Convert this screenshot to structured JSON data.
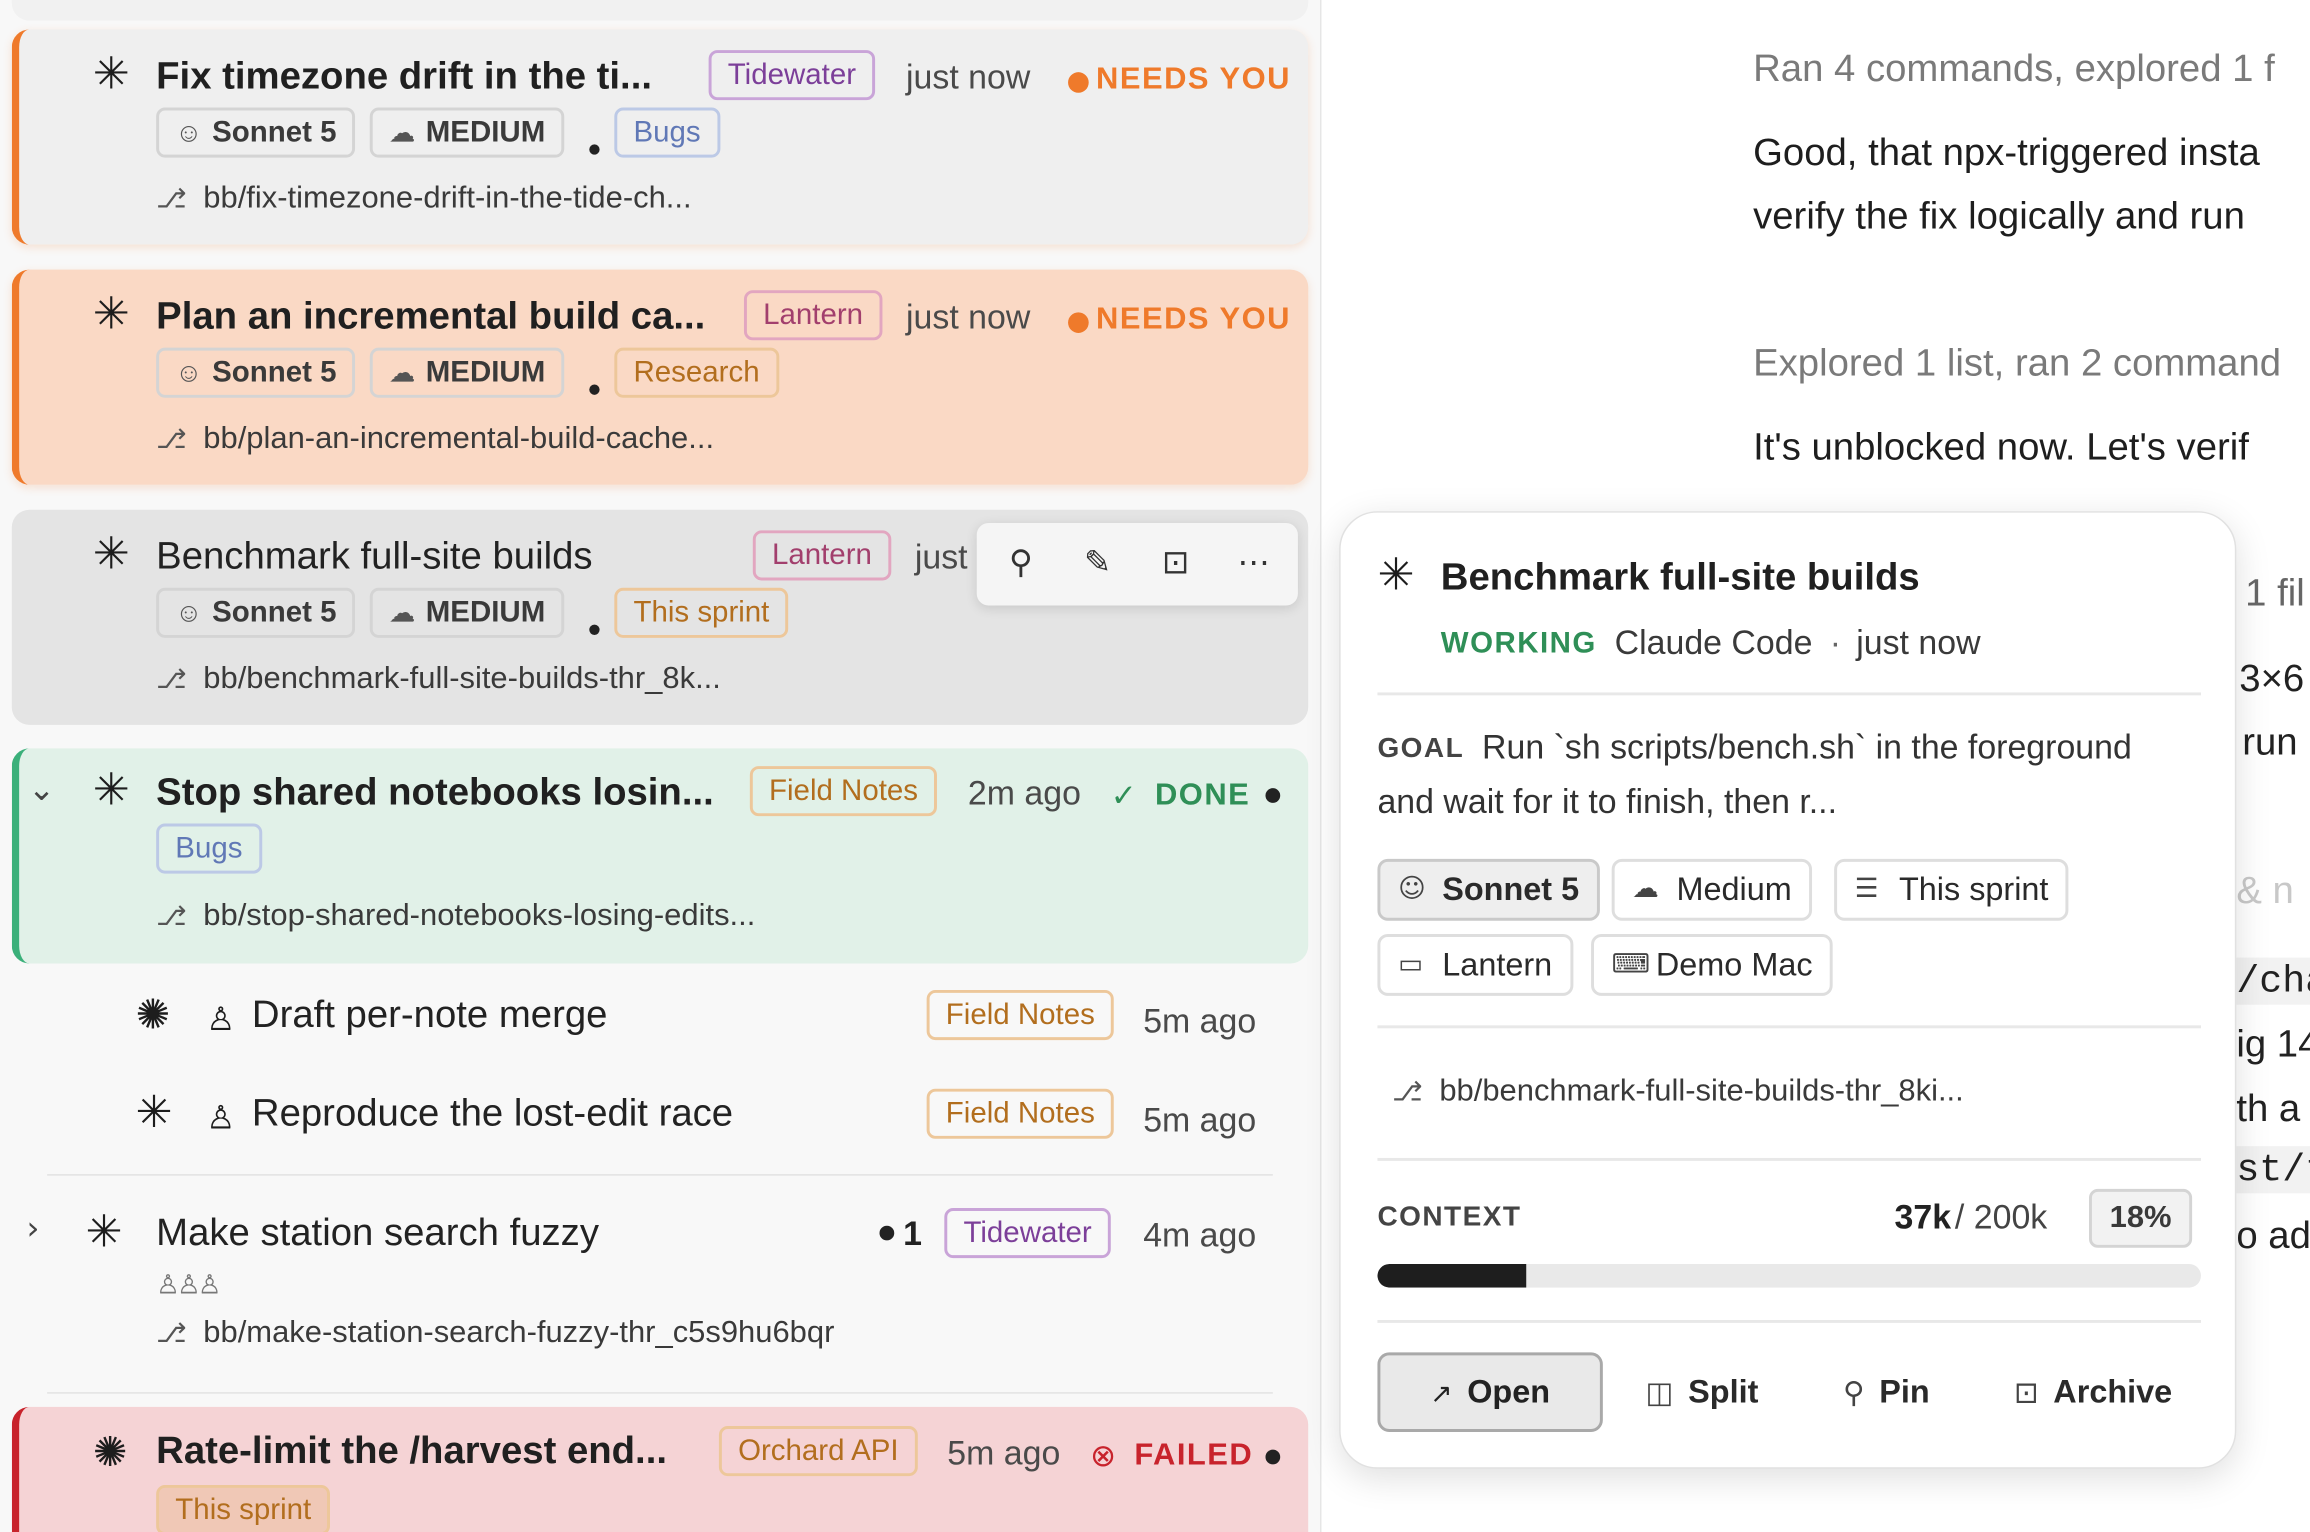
{
  "threads": [
    {
      "title": "Fix timezone drift in the ti...",
      "project": "Tidewater",
      "time": "just now",
      "status": "NEEDS YOU",
      "model": "Sonnet 5",
      "effort": "MEDIUM",
      "tag": "Bugs",
      "branch": "bb/fix-timezone-drift-in-the-tide-ch..."
    },
    {
      "title": "Plan an incremental build ca...",
      "project": "Lantern",
      "time": "just now",
      "status": "NEEDS YOU",
      "model": "Sonnet 5",
      "effort": "MEDIUM",
      "tag": "Research",
      "branch": "bb/plan-an-incremental-build-cache..."
    },
    {
      "title": "Benchmark full-site builds",
      "project": "Lantern",
      "time": "just",
      "model": "Sonnet 5",
      "effort": "MEDIUM",
      "tag": "This sprint",
      "branch": "bb/benchmark-full-site-builds-thr_8k..."
    },
    {
      "title": "Stop shared notebooks losin...",
      "project": "Field Notes",
      "time": "2m ago",
      "status": "DONE",
      "tag": "Bugs",
      "branch": "bb/stop-shared-notebooks-losing-edits..."
    },
    {
      "title": "Draft per-note merge",
      "project": "Field Notes",
      "time": "5m ago"
    },
    {
      "title": "Reproduce the lost-edit race",
      "project": "Field Notes",
      "time": "5m ago"
    },
    {
      "title": "Make station search fuzzy",
      "count": "1",
      "project": "Tidewater",
      "time": "4m ago",
      "branch": "bb/make-station-search-fuzzy-thr_c5s9hu6bqr"
    },
    {
      "title": "Rate-limit the /harvest end...",
      "project": "Orchard API",
      "time": "5m ago",
      "status": "FAILED",
      "tag": "This sprint"
    }
  ],
  "conversation": {
    "line1": "Ran 4 commands, explored 1 f",
    "line2": "Good, that npx-triggered insta",
    "line3": "verify the fix logically and run",
    "line4": "Explored 1 list, ran 2 command",
    "line5": "It's unblocked now. Let's verif",
    "clips": [
      "1 fil",
      "3×6",
      "run",
      "& n",
      "/cha",
      "ig 14",
      "th a",
      "st/t",
      "o ad"
    ]
  },
  "popover": {
    "title": "Benchmark full-site builds",
    "status": "WORKING",
    "agent": "Claude Code",
    "sep": "·",
    "time": "just now",
    "goal_label": "GOAL",
    "goal_line1": "Run `sh scripts/bench.sh` in the foreground",
    "goal_line2": "and wait for it to finish, then r...",
    "chips": [
      "Sonnet 5",
      "Medium",
      "This sprint",
      "Lantern",
      "Demo Mac"
    ],
    "branch": "bb/benchmark-full-site-builds-thr_8ki...",
    "context_label": "CONTEXT",
    "context_used": "37k",
    "context_total": " / 200k",
    "context_percent": "18%",
    "context_fraction": 0.18,
    "actions": {
      "open": "Open",
      "split": "Split",
      "pin": "Pin",
      "archive": "Archive"
    }
  },
  "colors": {
    "orange": "#ef7a2b",
    "green": "#2f8f57",
    "red": "#c8232c"
  }
}
